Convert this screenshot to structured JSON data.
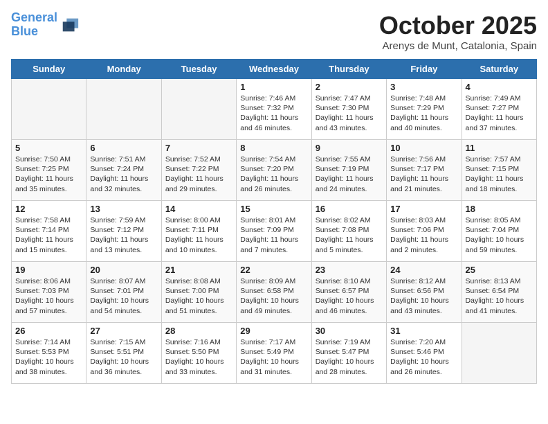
{
  "header": {
    "logo_line1": "General",
    "logo_line2": "Blue",
    "month": "October 2025",
    "location": "Arenys de Munt, Catalonia, Spain"
  },
  "weekdays": [
    "Sunday",
    "Monday",
    "Tuesday",
    "Wednesday",
    "Thursday",
    "Friday",
    "Saturday"
  ],
  "weeks": [
    [
      {
        "day": "",
        "empty": true
      },
      {
        "day": "",
        "empty": true
      },
      {
        "day": "",
        "empty": true
      },
      {
        "day": "1",
        "sunrise": "7:46 AM",
        "sunset": "7:32 PM",
        "daylight": "11 hours and 46 minutes."
      },
      {
        "day": "2",
        "sunrise": "7:47 AM",
        "sunset": "7:30 PM",
        "daylight": "11 hours and 43 minutes."
      },
      {
        "day": "3",
        "sunrise": "7:48 AM",
        "sunset": "7:29 PM",
        "daylight": "11 hours and 40 minutes."
      },
      {
        "day": "4",
        "sunrise": "7:49 AM",
        "sunset": "7:27 PM",
        "daylight": "11 hours and 37 minutes."
      }
    ],
    [
      {
        "day": "5",
        "sunrise": "7:50 AM",
        "sunset": "7:25 PM",
        "daylight": "11 hours and 35 minutes."
      },
      {
        "day": "6",
        "sunrise": "7:51 AM",
        "sunset": "7:24 PM",
        "daylight": "11 hours and 32 minutes."
      },
      {
        "day": "7",
        "sunrise": "7:52 AM",
        "sunset": "7:22 PM",
        "daylight": "11 hours and 29 minutes."
      },
      {
        "day": "8",
        "sunrise": "7:54 AM",
        "sunset": "7:20 PM",
        "daylight": "11 hours and 26 minutes."
      },
      {
        "day": "9",
        "sunrise": "7:55 AM",
        "sunset": "7:19 PM",
        "daylight": "11 hours and 24 minutes."
      },
      {
        "day": "10",
        "sunrise": "7:56 AM",
        "sunset": "7:17 PM",
        "daylight": "11 hours and 21 minutes."
      },
      {
        "day": "11",
        "sunrise": "7:57 AM",
        "sunset": "7:15 PM",
        "daylight": "11 hours and 18 minutes."
      }
    ],
    [
      {
        "day": "12",
        "sunrise": "7:58 AM",
        "sunset": "7:14 PM",
        "daylight": "11 hours and 15 minutes."
      },
      {
        "day": "13",
        "sunrise": "7:59 AM",
        "sunset": "7:12 PM",
        "daylight": "11 hours and 13 minutes."
      },
      {
        "day": "14",
        "sunrise": "8:00 AM",
        "sunset": "7:11 PM",
        "daylight": "11 hours and 10 minutes."
      },
      {
        "day": "15",
        "sunrise": "8:01 AM",
        "sunset": "7:09 PM",
        "daylight": "11 hours and 7 minutes."
      },
      {
        "day": "16",
        "sunrise": "8:02 AM",
        "sunset": "7:08 PM",
        "daylight": "11 hours and 5 minutes."
      },
      {
        "day": "17",
        "sunrise": "8:03 AM",
        "sunset": "7:06 PM",
        "daylight": "11 hours and 2 minutes."
      },
      {
        "day": "18",
        "sunrise": "8:05 AM",
        "sunset": "7:04 PM",
        "daylight": "10 hours and 59 minutes."
      }
    ],
    [
      {
        "day": "19",
        "sunrise": "8:06 AM",
        "sunset": "7:03 PM",
        "daylight": "10 hours and 57 minutes."
      },
      {
        "day": "20",
        "sunrise": "8:07 AM",
        "sunset": "7:01 PM",
        "daylight": "10 hours and 54 minutes."
      },
      {
        "day": "21",
        "sunrise": "8:08 AM",
        "sunset": "7:00 PM",
        "daylight": "10 hours and 51 minutes."
      },
      {
        "day": "22",
        "sunrise": "8:09 AM",
        "sunset": "6:58 PM",
        "daylight": "10 hours and 49 minutes."
      },
      {
        "day": "23",
        "sunrise": "8:10 AM",
        "sunset": "6:57 PM",
        "daylight": "10 hours and 46 minutes."
      },
      {
        "day": "24",
        "sunrise": "8:12 AM",
        "sunset": "6:56 PM",
        "daylight": "10 hours and 43 minutes."
      },
      {
        "day": "25",
        "sunrise": "8:13 AM",
        "sunset": "6:54 PM",
        "daylight": "10 hours and 41 minutes."
      }
    ],
    [
      {
        "day": "26",
        "sunrise": "7:14 AM",
        "sunset": "5:53 PM",
        "daylight": "10 hours and 38 minutes."
      },
      {
        "day": "27",
        "sunrise": "7:15 AM",
        "sunset": "5:51 PM",
        "daylight": "10 hours and 36 minutes."
      },
      {
        "day": "28",
        "sunrise": "7:16 AM",
        "sunset": "5:50 PM",
        "daylight": "10 hours and 33 minutes."
      },
      {
        "day": "29",
        "sunrise": "7:17 AM",
        "sunset": "5:49 PM",
        "daylight": "10 hours and 31 minutes."
      },
      {
        "day": "30",
        "sunrise": "7:19 AM",
        "sunset": "5:47 PM",
        "daylight": "10 hours and 28 minutes."
      },
      {
        "day": "31",
        "sunrise": "7:20 AM",
        "sunset": "5:46 PM",
        "daylight": "10 hours and 26 minutes."
      },
      {
        "day": "",
        "empty": true
      }
    ]
  ]
}
